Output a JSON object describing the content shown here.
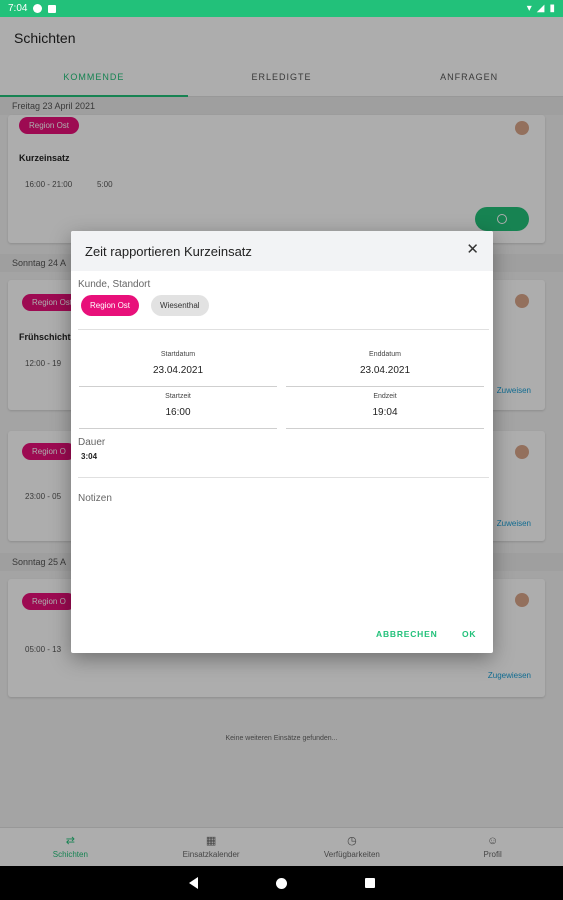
{
  "statusbar": {
    "time": "7:04"
  },
  "appbar": {
    "title": "Schichten"
  },
  "tabs": [
    {
      "label": "KOMMENDE"
    },
    {
      "label": "ERLEDIGTE"
    },
    {
      "label": "ANFRAGEN"
    }
  ],
  "list": {
    "date1": "Freitag 23 April 2021",
    "card1": {
      "region": "Region Ost",
      "title": "Kurzeinsatz",
      "time": "16:00 - 21:00",
      "duration": "5:00"
    },
    "date2": "Sonntag 24 A",
    "card2": {
      "region": "Region Ost",
      "title": "Frühschicht",
      "time": "12:00 - 19",
      "link": "Zuweisen"
    },
    "card3": {
      "region": "Region O",
      "time": "23:00 - 05",
      "link": "Zuweisen"
    },
    "date3": "Sonntag 25 A",
    "card4": {
      "region": "Region O",
      "time": "05:00 - 13",
      "link": "Zugewiesen"
    },
    "footer_note": "Keine weiteren Einsätze gefunden..."
  },
  "bottomnav": [
    {
      "label": "Schichten",
      "icon": "swap-icon"
    },
    {
      "label": "Einsatzkalender",
      "icon": "calendar-icon"
    },
    {
      "label": "Verfügbarkeiten",
      "icon": "clock-icon"
    },
    {
      "label": "Profil",
      "icon": "person-icon"
    }
  ],
  "dialog": {
    "title": "Zeit rapportieren Kurzeinsatz",
    "customer_label": "Kunde, Standort",
    "chip_region": "Region Ost",
    "chip_location": "Wiesenthal",
    "startdatum_label": "Startdatum",
    "startdatum_value": "23.04.2021",
    "enddatum_label": "Enddatum",
    "enddatum_value": "23.04.2021",
    "startzeit_label": "Startzeit",
    "startzeit_value": "16:00",
    "endzeit_label": "Endzeit",
    "endzeit_value": "19:04",
    "dauer_label": "Dauer",
    "dauer_value": "3:04",
    "notizen_label": "Notizen",
    "cancel_label": "ABBRECHEN",
    "ok_label": "OK"
  },
  "colors": {
    "accent": "#22c17a",
    "region_pink": "#e8107a",
    "link_blue": "#1a9fd6"
  }
}
